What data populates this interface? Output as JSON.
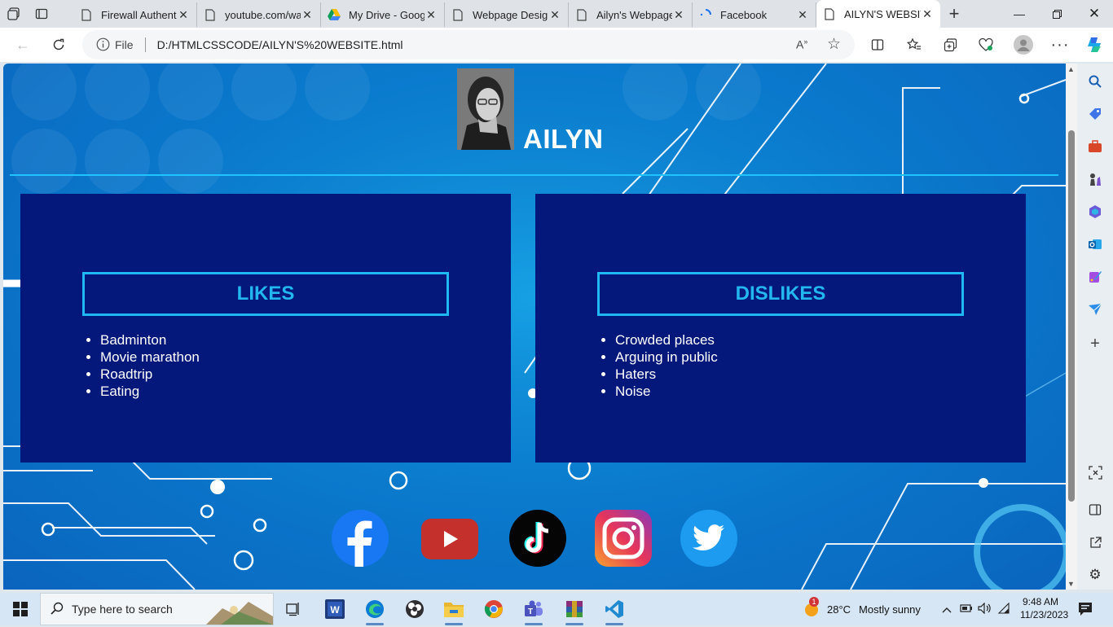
{
  "browser": {
    "tabs": [
      {
        "title": "Firewall Authent",
        "icon": "page-icon"
      },
      {
        "title": "youtube.com/wa",
        "icon": "page-icon"
      },
      {
        "title": "My Drive - Goog",
        "icon": "google-drive-icon"
      },
      {
        "title": "Webpage Desig",
        "icon": "page-icon"
      },
      {
        "title": "Ailyn's Webpage",
        "icon": "page-icon"
      },
      {
        "title": "Facebook",
        "icon": "loading-icon"
      },
      {
        "title": "AILYN'S WEBSITE",
        "icon": "page-icon",
        "active": true
      }
    ],
    "address": {
      "scheme_label": "File",
      "url": "D:/HTMLCSSCODE/AILYN'S%20WEBSITE.html"
    }
  },
  "page": {
    "title": "AILYN",
    "likes": {
      "heading": "LIKES",
      "items": [
        "Badminton",
        "Movie marathon",
        "Roadtrip",
        "Eating"
      ]
    },
    "dislikes": {
      "heading": "DISLIKES",
      "items": [
        "Crowded places",
        "Arguing in public",
        "Haters",
        "Noise"
      ]
    },
    "social": [
      "facebook-icon",
      "youtube-icon",
      "tiktok-icon",
      "instagram-icon",
      "twitter-icon"
    ],
    "colors": {
      "panel": "#03187a",
      "accent": "#1fb8f2",
      "background": "#0a7fd1"
    }
  },
  "taskbar": {
    "search_placeholder": "Type here to search",
    "weather_temp": "28°C",
    "weather_text": "Mostly sunny",
    "weather_badge": "1",
    "time": "9:48 AM",
    "date": "11/23/2023"
  }
}
